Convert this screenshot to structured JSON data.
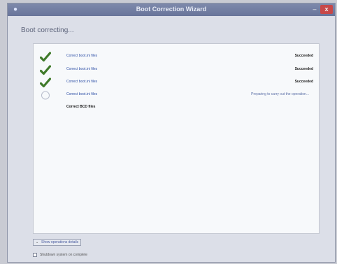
{
  "window": {
    "title": "Boot Correction Wizard",
    "minimize_glyph": "–",
    "close_glyph": "x"
  },
  "header": {
    "status": "Boot correcting..."
  },
  "operations": [
    {
      "label": "Correct boot.ini files",
      "status": "Succeeded",
      "state": "success",
      "icon": "checkmark-icon"
    },
    {
      "label": "Correct boot.ini files",
      "status": "Succeeded",
      "state": "success",
      "icon": "checkmark-icon"
    },
    {
      "label": "Correct boot.ini files",
      "status": "Succeeded",
      "state": "success",
      "icon": "checkmark-icon"
    },
    {
      "label": "Correct boot.ini files",
      "status": "Preparing to carry out the operation...",
      "state": "in-progress",
      "icon": "progress-ring-icon"
    },
    {
      "label": "Correct BCD files",
      "status": "",
      "state": "pending",
      "icon": ""
    }
  ],
  "footer": {
    "details_toggle_label": "Show operations details",
    "shutdown_label": "Shutdown system on complete",
    "shutdown_checked": false
  },
  "colors": {
    "success_check": "#3f7a2a",
    "titlebar": "#6f7ba0",
    "close_button": "#c74848"
  }
}
